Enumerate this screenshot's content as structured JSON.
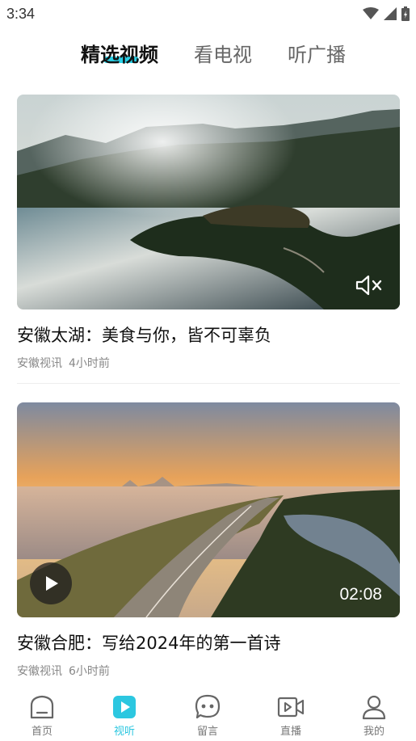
{
  "status_bar": {
    "time": "3:34"
  },
  "top_tabs": [
    {
      "label": "精选视频",
      "active": true
    },
    {
      "label": "看电视",
      "active": false
    },
    {
      "label": "听广播",
      "active": false
    }
  ],
  "videos": [
    {
      "title": "安徽太湖：美食与你，皆不可辜负",
      "source": "安徽视讯",
      "time": "4小时前",
      "overlay_icon": "mute-icon"
    },
    {
      "title": "安徽合肥：写给2024年的第一首诗",
      "source": "安徽视讯",
      "time": "6小时前",
      "duration": "02:08",
      "overlay_icon": "play-icon"
    }
  ],
  "bottom_nav": [
    {
      "label": "首页",
      "icon": "home-icon",
      "active": false
    },
    {
      "label": "视听",
      "icon": "video-play-icon",
      "active": true
    },
    {
      "label": "留言",
      "icon": "message-icon",
      "active": false
    },
    {
      "label": "直播",
      "icon": "live-camera-icon",
      "active": false
    },
    {
      "label": "我的",
      "icon": "user-icon",
      "active": false
    }
  ],
  "colors": {
    "accent": "#2cc7e0",
    "text_primary": "#111111",
    "text_secondary": "#888888"
  }
}
